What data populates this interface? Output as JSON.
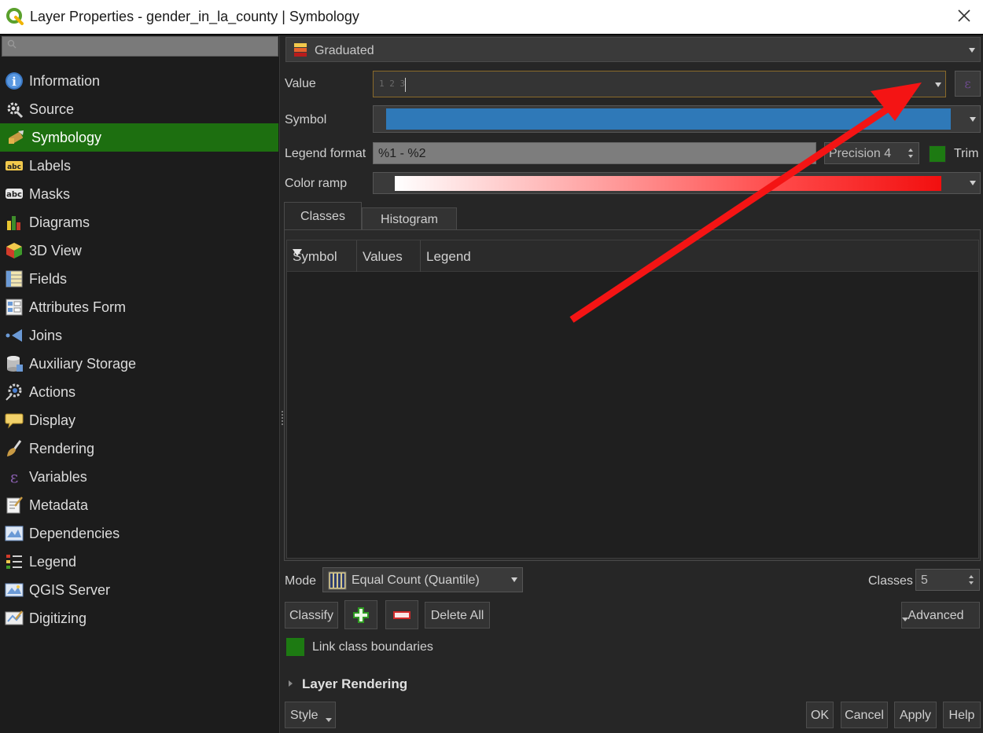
{
  "window": {
    "title": "Layer Properties - gender_in_la_county | Symbology"
  },
  "sidebar": {
    "search_placeholder": "",
    "items": [
      {
        "label": "Information",
        "icon": "info-icon"
      },
      {
        "label": "Source",
        "icon": "source-icon"
      },
      {
        "label": "Symbology",
        "icon": "symbology-icon",
        "active": true
      },
      {
        "label": "Labels",
        "icon": "labels-icon"
      },
      {
        "label": "Masks",
        "icon": "masks-icon"
      },
      {
        "label": "Diagrams",
        "icon": "diagrams-icon"
      },
      {
        "label": "3D View",
        "icon": "3d-view-icon"
      },
      {
        "label": "Fields",
        "icon": "fields-icon"
      },
      {
        "label": "Attributes Form",
        "icon": "attributes-form-icon"
      },
      {
        "label": "Joins",
        "icon": "joins-icon"
      },
      {
        "label": "Auxiliary Storage",
        "icon": "auxiliary-storage-icon"
      },
      {
        "label": "Actions",
        "icon": "actions-icon"
      },
      {
        "label": "Display",
        "icon": "display-icon"
      },
      {
        "label": "Rendering",
        "icon": "rendering-icon"
      },
      {
        "label": "Variables",
        "icon": "variables-icon"
      },
      {
        "label": "Metadata",
        "icon": "metadata-icon"
      },
      {
        "label": "Dependencies",
        "icon": "dependencies-icon"
      },
      {
        "label": "Legend",
        "icon": "legend-icon"
      },
      {
        "label": "QGIS Server",
        "icon": "qgis-server-icon"
      },
      {
        "label": "Digitizing",
        "icon": "digitizing-icon"
      }
    ]
  },
  "symbology": {
    "renderer": "Graduated",
    "value_label": "Value",
    "value_type_glyph": "1 2 3",
    "value": "",
    "symbol_label": "Symbol",
    "symbol_color": "#2f79b8",
    "legend_format_label": "Legend format",
    "legend_format": "%1 - %2",
    "precision": "Precision 4",
    "trim_label": "Trim",
    "color_ramp_label": "Color ramp",
    "expression_glyph": "ε"
  },
  "tabs": {
    "classes": "Classes",
    "histogram": "Histogram"
  },
  "table": {
    "headers": [
      "Symbol",
      "Values",
      "Legend"
    ],
    "rows": []
  },
  "controls": {
    "mode_label": "Mode",
    "mode_value": "Equal Count (Quantile)",
    "classes_label": "Classes",
    "classes_value": "5",
    "classify": "Classify",
    "delete_all": "Delete All",
    "advanced": "Advanced",
    "link_class_boundaries": "Link class boundaries",
    "layer_rendering": "Layer Rendering",
    "style": "Style",
    "ok": "OK",
    "cancel": "Cancel",
    "apply": "Apply",
    "help": "Help"
  },
  "colors": {
    "active_nav": "#1d6f10",
    "checkbox_checked": "#1d7a12",
    "annotation_arrow": "#f41414"
  }
}
